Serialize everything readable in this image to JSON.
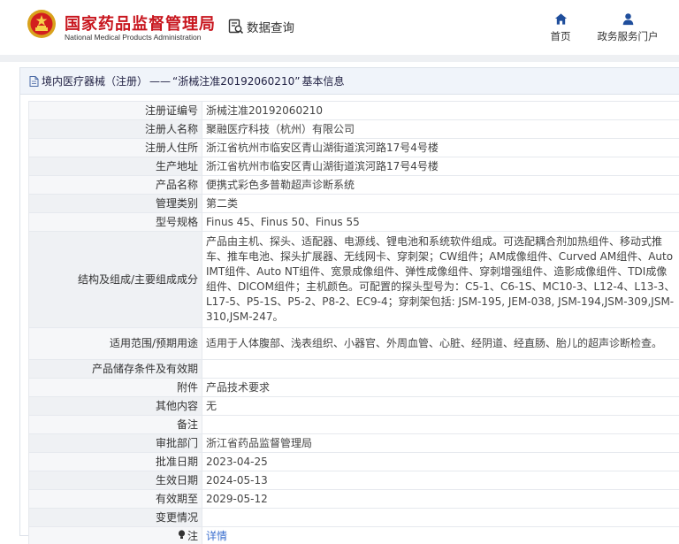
{
  "header": {
    "logo_cn": "国家药品监督管理局",
    "logo_en": "National Medical Products Administration",
    "emblem_icon": "national-emblem-icon",
    "query_label": "数据查询",
    "query_icon": "search-document-icon",
    "nav": [
      {
        "label": "首页",
        "icon": "home-icon"
      },
      {
        "label": "政务服务门户",
        "icon": "user-icon"
      }
    ],
    "brand_color": "#c8161e",
    "nav_icon_color": "#1f4e9c"
  },
  "title": {
    "icon": "document-icon",
    "category": "境内医疗器械（注册）",
    "separator": "——",
    "name": "“浙械注准20192060210”",
    "suffix": "基本信息"
  },
  "rows": [
    {
      "key": "注册证编号",
      "value": "浙械注准20192060210"
    },
    {
      "key": "注册人名称",
      "value": "聚融医疗科技（杭州）有限公司"
    },
    {
      "key": "注册人住所",
      "value": "浙江省杭州市临安区青山湖街道滨河路17号4号楼"
    },
    {
      "key": "生产地址",
      "value": "浙江省杭州市临安区青山湖街道滨河路17号4号楼"
    },
    {
      "key": "产品名称",
      "value": "便携式彩色多普勒超声诊断系统"
    },
    {
      "key": "管理类别",
      "value": "第二类"
    },
    {
      "key": "型号规格",
      "value": "Finus 45、Finus 50、Finus 55"
    },
    {
      "key": "结构及组成/主要组成成分",
      "value": "产品由主机、探头、适配器、电源线、锂电池和系统软件组成。可选配耦合剂加热组件、移动式推车、推车电池、探头扩展器、无线网卡、穿刺架；CW组件；AM成像组件、Curved AM组件、Auto IMT组件、Auto NT组件、宽景成像组件、弹性成像组件、穿刺增强组件、造影成像组件、TDI成像组件、DICOM组件；主机颜色。可配置的探头型号为：C5-1、C6-1S、MC10-3、L12-4、L13-3、L17-5、P5-1S、P5-2、P8-2、EC9-4；穿刺架包括: JSM-195, JEM-038, JSM-194,JSM-309,JSM-310,JSM-247。"
    },
    {
      "key": "适用范围/预期用途",
      "value": "适用于人体腹部、浅表组织、小器官、外周血管、心脏、经阴道、经直肠、胎儿的超声诊断检查。"
    },
    {
      "key": "产品储存条件及有效期",
      "value": ""
    },
    {
      "key": "附件",
      "value": "产品技术要求"
    },
    {
      "key": "其他内容",
      "value": "无"
    },
    {
      "key": "备注",
      "value": ""
    },
    {
      "key": "审批部门",
      "value": "浙江省药品监督管理局"
    },
    {
      "key": "批准日期",
      "value": "2023-04-25"
    },
    {
      "key": "生效日期",
      "value": "2024-05-13"
    },
    {
      "key": "有效期至",
      "value": "2029-05-12"
    },
    {
      "key": "变更情况",
      "value": ""
    }
  ],
  "note": {
    "key": "注",
    "icon": "lightbulb-icon",
    "link": "详情"
  }
}
